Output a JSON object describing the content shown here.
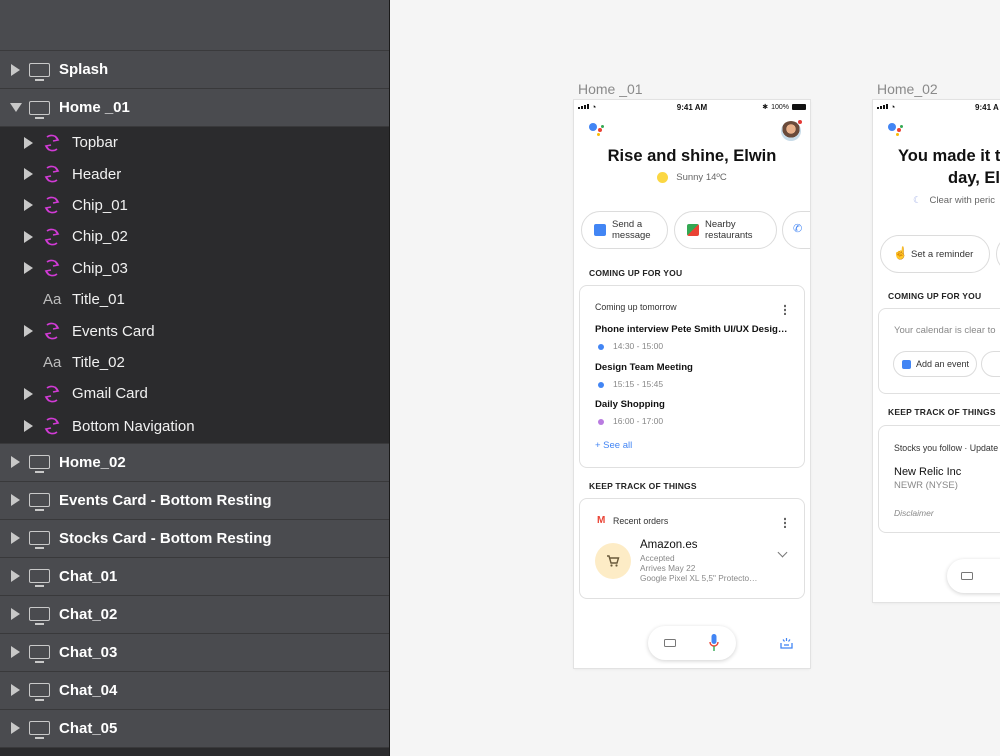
{
  "layers": {
    "artboards_top": [
      {
        "label": "Splash",
        "expanded": false
      },
      {
        "label": "Home _01",
        "expanded": true
      }
    ],
    "home01_children": [
      {
        "label": "Topbar",
        "kind": "symbol"
      },
      {
        "label": "Header",
        "kind": "symbol"
      },
      {
        "label": "Chip_01",
        "kind": "symbol"
      },
      {
        "label": "Chip_02",
        "kind": "symbol"
      },
      {
        "label": "Chip_03",
        "kind": "symbol"
      },
      {
        "label": "Title_01",
        "kind": "text",
        "icon_text": "Aa"
      },
      {
        "label": "Events Card",
        "kind": "symbol"
      },
      {
        "label": "Title_02",
        "kind": "text",
        "icon_text": "Aa"
      },
      {
        "label": "Gmail Card",
        "kind": "symbol"
      },
      {
        "label": "Bottom Navigation",
        "kind": "symbol"
      }
    ],
    "artboards_bottom": [
      {
        "label": "Home_02"
      },
      {
        "label": "Events Card - Bottom Resting"
      },
      {
        "label": "Stocks Card - Bottom Resting"
      },
      {
        "label": "Chat_01"
      },
      {
        "label": "Chat_02"
      },
      {
        "label": "Chat_03"
      },
      {
        "label": "Chat_04"
      },
      {
        "label": "Chat_05"
      }
    ]
  },
  "canvas": {
    "home01": {
      "title": "Home _01",
      "status": {
        "time": "9:41 AM",
        "battery": "100%"
      },
      "greeting": "Rise and shine, Elwin",
      "weather": "Sunny 14ºC",
      "chips": [
        {
          "line1": "Send a",
          "line2": "message",
          "icon": "message-icon"
        },
        {
          "line1": "Nearby",
          "line2": "restaurants",
          "icon": "map-icon"
        }
      ],
      "section1": "COMING UP FOR YOU",
      "events_card": {
        "header": "Coming up tomorrow",
        "events": [
          {
            "title": "Phone interview Pete Smith UI/UX Desig…",
            "time": "14:30 - 15:00",
            "color": "#4285f4"
          },
          {
            "title": "Design Team Meeting",
            "time": "15:15 - 15:45",
            "color": "#4285f4"
          },
          {
            "title": "Daily Shopping",
            "time": "16:00 - 17:00",
            "color": "#b97be0"
          }
        ],
        "see_all": "+ See all"
      },
      "section2": "KEEP TRACK OF THINGS",
      "orders_card": {
        "header": "Recent orders",
        "store": "Amazon.es",
        "status": "Accepted",
        "arrives": "Arrives May 22",
        "product": "Google Pixel XL 5,5\" Protecto…"
      }
    },
    "home02": {
      "title": "Home_02",
      "status": {
        "time": "9:41 A"
      },
      "greeting_l1": "You made it th",
      "greeting_l2": "day, El",
      "weather": "Clear with peric",
      "chip": "Set a reminder",
      "section1": "COMING UP FOR YOU",
      "calendar_text": "Your calendar is clear to",
      "add_event": "Add an event",
      "section2": "KEEP TRACK OF THINGS",
      "stocks_header": "Stocks you follow · Update",
      "stock_name": "New Relic Inc",
      "stock_ticker": "NEWR (NYSE)",
      "disclaimer": "Disclaimer"
    }
  },
  "colors": {
    "panel": "#2b2b2d",
    "artboard_row": "#4a4b4f",
    "symbol": "#d23bd6",
    "google_blue": "#4285f4"
  }
}
